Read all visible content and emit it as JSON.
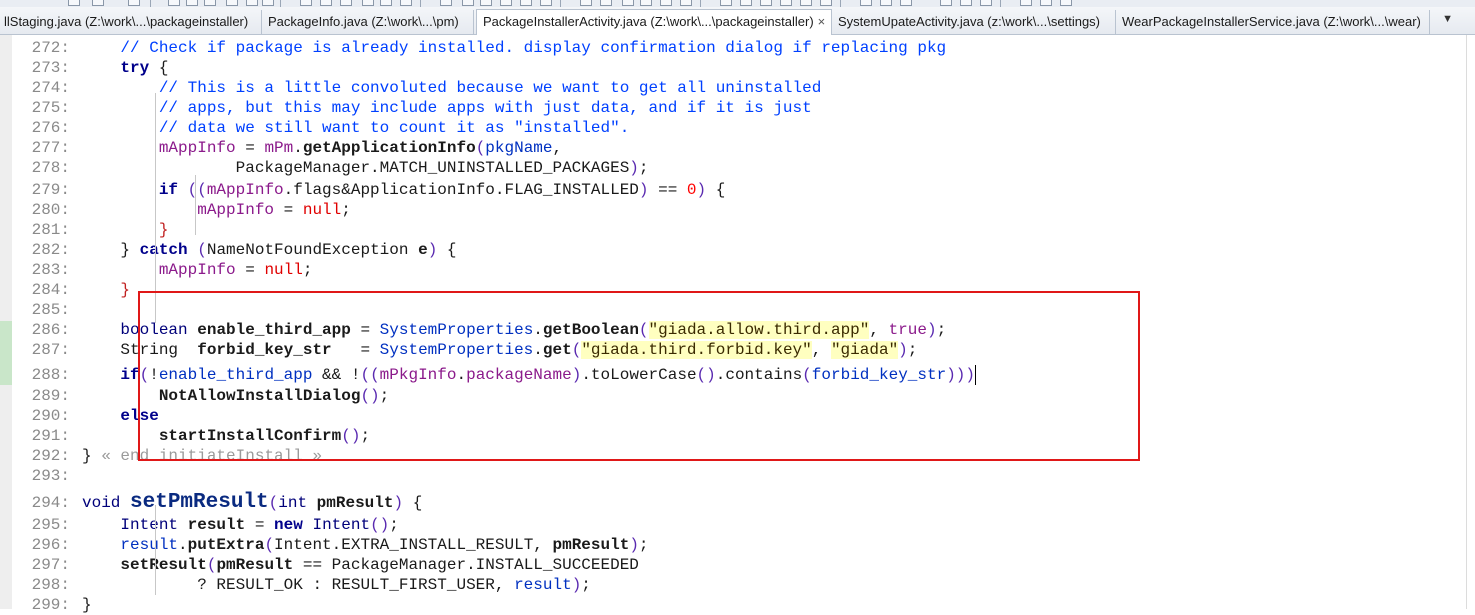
{
  "tabs": [
    {
      "label": "llStaging.java (Z:\\work\\...\\packageinstaller)",
      "active": false
    },
    {
      "label": "PackageInfo.java (Z:\\work\\...\\pm)",
      "active": false
    },
    {
      "label": "PackageInstallerActivity.java (Z:\\work\\...\\packageinstaller)",
      "active": true
    },
    {
      "label": "SystemUpateActivity.java (z:\\work\\...\\settings)",
      "active": false
    },
    {
      "label": "WearPackageInstallerService.java (Z:\\work\\...\\wear)",
      "active": false
    }
  ],
  "tab_close_glyph": "×",
  "tab_scroll_glyph": "▼",
  "toolbar_icons": [
    "tool-icon"
  ],
  "colors": {
    "highlight_box": "#e01818",
    "comment": "#0040ff",
    "keyword": "#00008b",
    "change_marker": "#c9e6c9"
  },
  "lines": [
    {
      "num": "272:",
      "indent": "    ",
      "tokens": [
        {
          "t": "// Check if package is already installed. display confirmation dialog if replacing pkg",
          "c": "cm"
        }
      ]
    },
    {
      "num": "273:",
      "indent": "    ",
      "tokens": [
        {
          "t": "try",
          "c": "kw"
        },
        {
          "t": " {",
          "c": ""
        }
      ]
    },
    {
      "num": "274:",
      "indent": "        ",
      "tokens": [
        {
          "t": "// This is a little convoluted because we want to get all uninstalled",
          "c": "cm"
        }
      ]
    },
    {
      "num": "275:",
      "indent": "        ",
      "tokens": [
        {
          "t": "// apps, but this may include apps with just data, and if it is just",
          "c": "cm"
        }
      ]
    },
    {
      "num": "276:",
      "indent": "        ",
      "tokens": [
        {
          "t": "// data we still want to count it as \"installed\".",
          "c": "cm"
        }
      ]
    },
    {
      "num": "277:",
      "indent": "        ",
      "tokens": [
        {
          "t": "mAppInfo",
          "c": "fld"
        },
        {
          "t": " = ",
          "c": ""
        },
        {
          "t": "mPm",
          "c": "fld"
        },
        {
          "t": ".",
          "c": ""
        },
        {
          "t": "getApplicationInfo",
          "c": "meth"
        },
        {
          "t": "(",
          "c": "par"
        },
        {
          "t": "pkgName",
          "c": "cls"
        },
        {
          "t": ",",
          "c": ""
        }
      ]
    },
    {
      "num": "278:",
      "indent": "                ",
      "tokens": [
        {
          "t": "PackageManager.MATCH_UNINSTALLED_PACKAGES",
          "c": ""
        },
        {
          "t": ")",
          "c": "par"
        },
        {
          "t": ";",
          "c": ""
        }
      ]
    },
    {
      "num": "279:",
      "indent": "        ",
      "tokens": [
        {
          "t": "if",
          "c": "kw"
        },
        {
          "t": " ",
          "c": ""
        },
        {
          "t": "((",
          "c": "par"
        },
        {
          "t": "mAppInfo",
          "c": "fld"
        },
        {
          "t": ".flags&ApplicationInfo.FLAG_INSTALLED",
          "c": ""
        },
        {
          "t": ")",
          "c": "par"
        },
        {
          "t": " == ",
          "c": ""
        },
        {
          "t": "0",
          "c": "num"
        },
        {
          "t": ")",
          "c": "par"
        },
        {
          "t": " {",
          "c": ""
        }
      ]
    },
    {
      "num": "280:",
      "indent": "            ",
      "tokens": [
        {
          "t": "mAppInfo",
          "c": "fld"
        },
        {
          "t": " = ",
          "c": ""
        },
        {
          "t": "null",
          "c": "null"
        },
        {
          "t": ";",
          "c": ""
        }
      ]
    },
    {
      "num": "281:",
      "indent": "        ",
      "tokens": [
        {
          "t": "}",
          "c": "br"
        }
      ]
    },
    {
      "num": "282:",
      "indent": "    ",
      "tokens": [
        {
          "t": "}",
          "c": ""
        },
        {
          "t": " catch",
          "c": "kw"
        },
        {
          "t": " ",
          "c": ""
        },
        {
          "t": "(",
          "c": "par"
        },
        {
          "t": "NameNotFoundException ",
          "c": ""
        },
        {
          "t": "e",
          "c": "meth"
        },
        {
          "t": ")",
          "c": "par"
        },
        {
          "t": " {",
          "c": ""
        }
      ]
    },
    {
      "num": "283:",
      "indent": "        ",
      "tokens": [
        {
          "t": "mAppInfo",
          "c": "fld"
        },
        {
          "t": " = ",
          "c": ""
        },
        {
          "t": "null",
          "c": "null"
        },
        {
          "t": ";",
          "c": ""
        }
      ]
    },
    {
      "num": "284:",
      "indent": "    ",
      "tokens": [
        {
          "t": "}",
          "c": "br"
        }
      ]
    },
    {
      "num": "285:",
      "indent": "",
      "tokens": []
    },
    {
      "num": "286:",
      "indent": "    ",
      "tokens": [
        {
          "t": "boolean",
          "c": "type"
        },
        {
          "t": " ",
          "c": ""
        },
        {
          "t": "enable_third_app",
          "c": "meth"
        },
        {
          "t": " = ",
          "c": ""
        },
        {
          "t": "SystemProperties",
          "c": "cls"
        },
        {
          "t": ".",
          "c": ""
        },
        {
          "t": "getBoolean",
          "c": "meth"
        },
        {
          "t": "(",
          "c": "par"
        },
        {
          "t": "\"giada.allow.third.app\"",
          "c": "str"
        },
        {
          "t": ", ",
          "c": ""
        },
        {
          "t": "true",
          "c": "fld"
        },
        {
          "t": ")",
          "c": "par"
        },
        {
          "t": ";",
          "c": ""
        }
      ]
    },
    {
      "num": "287:",
      "indent": "    ",
      "tokens": [
        {
          "t": "String",
          "c": ""
        },
        {
          "t": "  ",
          "c": ""
        },
        {
          "t": "forbid_key_str",
          "c": "meth"
        },
        {
          "t": "   = ",
          "c": ""
        },
        {
          "t": "SystemProperties",
          "c": "cls"
        },
        {
          "t": ".",
          "c": ""
        },
        {
          "t": "get",
          "c": "meth"
        },
        {
          "t": "(",
          "c": "par"
        },
        {
          "t": "\"giada.third.forbid.key\"",
          "c": "str"
        },
        {
          "t": ", ",
          "c": ""
        },
        {
          "t": "\"giada\"",
          "c": "str"
        },
        {
          "t": ")",
          "c": "par"
        },
        {
          "t": ";",
          "c": ""
        }
      ]
    },
    {
      "num": "288:",
      "indent": "    ",
      "tokens": [
        {
          "t": "if",
          "c": "kw"
        },
        {
          "t": "(",
          "c": "par"
        },
        {
          "t": "!",
          "c": ""
        },
        {
          "t": "enable_third_app",
          "c": "cls"
        },
        {
          "t": " && !",
          "c": ""
        },
        {
          "t": "((",
          "c": "par"
        },
        {
          "t": "mPkgInfo",
          "c": "fld"
        },
        {
          "t": ".",
          "c": ""
        },
        {
          "t": "packageName",
          "c": "fld"
        },
        {
          "t": ")",
          "c": "par"
        },
        {
          "t": ".toLowerCase",
          "c": ""
        },
        {
          "t": "()",
          "c": "par"
        },
        {
          "t": ".contains",
          "c": ""
        },
        {
          "t": "(",
          "c": "par"
        },
        {
          "t": "forbid_key_str",
          "c": "cls"
        },
        {
          "t": ")))",
          "c": "par"
        }
      ]
    },
    {
      "num": "289:",
      "indent": "        ",
      "tokens": [
        {
          "t": "NotAllowInstallDialog",
          "c": "meth"
        },
        {
          "t": "()",
          "c": "par"
        },
        {
          "t": ";",
          "c": ""
        }
      ]
    },
    {
      "num": "290:",
      "indent": "    ",
      "tokens": [
        {
          "t": "else",
          "c": "kw"
        }
      ]
    },
    {
      "num": "291:",
      "indent": "        ",
      "tokens": [
        {
          "t": "startInstallConfirm",
          "c": "meth"
        },
        {
          "t": "()",
          "c": "par"
        },
        {
          "t": ";",
          "c": ""
        }
      ]
    },
    {
      "num": "292:",
      "indent": "",
      "tokens": [
        {
          "t": "}",
          "c": ""
        },
        {
          "t": " « end initiateInstall »",
          "c": "fold-text"
        }
      ]
    },
    {
      "num": "293:",
      "indent": "",
      "tokens": []
    },
    {
      "num": "294:",
      "indent": "",
      "tokens": [
        {
          "t": "void",
          "c": "type"
        },
        {
          "t": " ",
          "c": ""
        },
        {
          "t": "setPmResult",
          "c": "bigname"
        },
        {
          "t": "(",
          "c": "par"
        },
        {
          "t": "int",
          "c": "type"
        },
        {
          "t": " ",
          "c": ""
        },
        {
          "t": "pmResult",
          "c": "meth"
        },
        {
          "t": ")",
          "c": "par"
        },
        {
          "t": " {",
          "c": ""
        }
      ]
    },
    {
      "num": "295:",
      "indent": "    ",
      "tokens": [
        {
          "t": "Intent",
          "c": "type"
        },
        {
          "t": " ",
          "c": ""
        },
        {
          "t": "result",
          "c": "meth"
        },
        {
          "t": " = ",
          "c": ""
        },
        {
          "t": "new",
          "c": "kw"
        },
        {
          "t": " ",
          "c": ""
        },
        {
          "t": "Intent",
          "c": "type"
        },
        {
          "t": "()",
          "c": "par"
        },
        {
          "t": ";",
          "c": ""
        }
      ]
    },
    {
      "num": "296:",
      "indent": "    ",
      "tokens": [
        {
          "t": "result",
          "c": "cls"
        },
        {
          "t": ".",
          "c": ""
        },
        {
          "t": "putExtra",
          "c": "meth"
        },
        {
          "t": "(",
          "c": "par"
        },
        {
          "t": "Intent.EXTRA_INSTALL_RESULT, ",
          "c": ""
        },
        {
          "t": "pmResult",
          "c": "meth"
        },
        {
          "t": ")",
          "c": "par"
        },
        {
          "t": ";",
          "c": ""
        }
      ]
    },
    {
      "num": "297:",
      "indent": "    ",
      "tokens": [
        {
          "t": "setResult",
          "c": "meth"
        },
        {
          "t": "(",
          "c": "par"
        },
        {
          "t": "pmResult",
          "c": "meth"
        },
        {
          "t": " == PackageManager.INSTALL_SUCCEEDED",
          "c": ""
        }
      ]
    },
    {
      "num": "298:",
      "indent": "            ",
      "tokens": [
        {
          "t": "? RESULT_OK : RESULT_FIRST_USER, ",
          "c": ""
        },
        {
          "t": "result",
          "c": "cls"
        },
        {
          "t": ")",
          "c": "par"
        },
        {
          "t": ";",
          "c": ""
        }
      ]
    },
    {
      "num": "299:",
      "indent": "",
      "tokens": [
        {
          "t": "}",
          "c": ""
        }
      ]
    }
  ]
}
